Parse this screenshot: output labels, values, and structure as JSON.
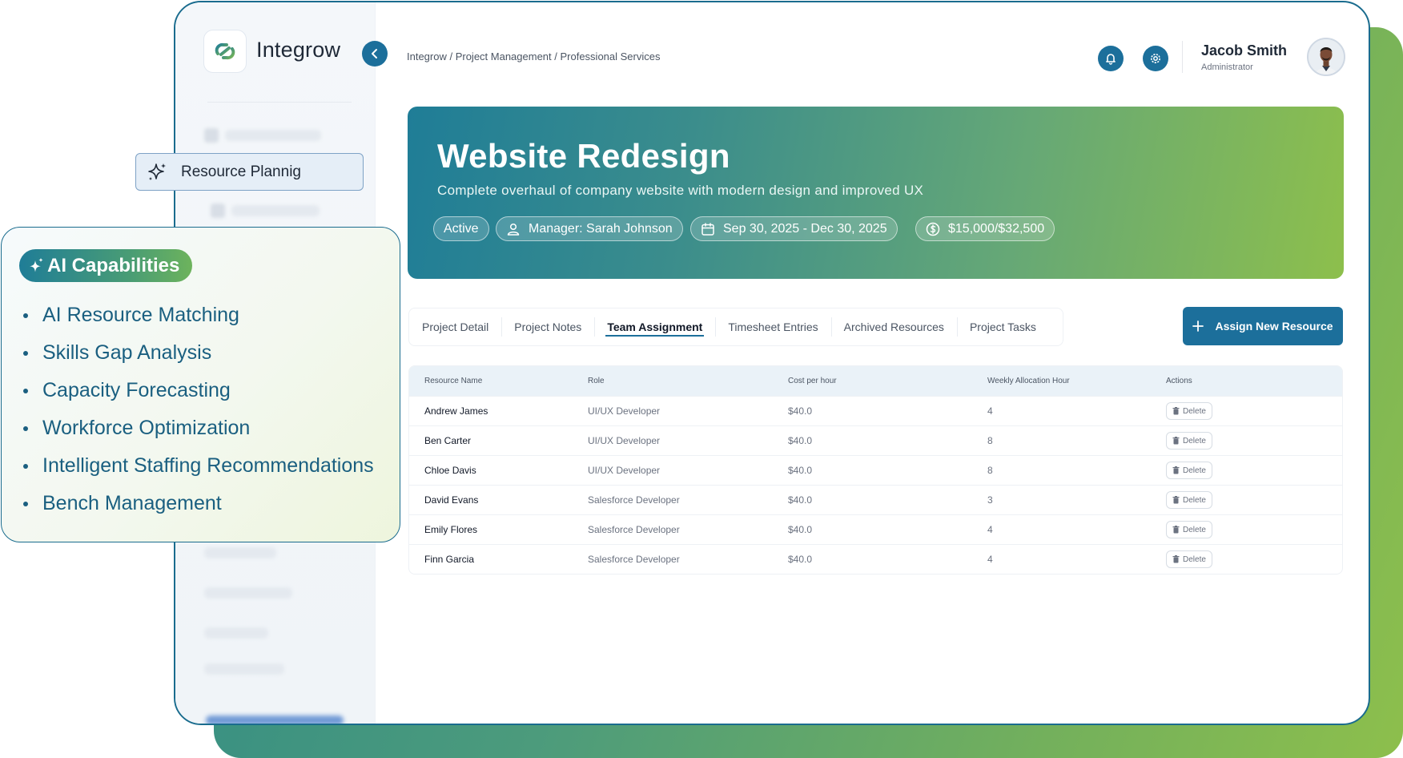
{
  "app": {
    "brand": "Integrow"
  },
  "breadcrumb": "Integrow / Project Management / Professional Services",
  "user": {
    "name": "Jacob Smith",
    "role": "Administrator"
  },
  "project": {
    "title": "Website Redesign",
    "description": "Complete overhaul of company website with modern design and improved UX",
    "status": "Active",
    "manager": "Manager: Sarah Johnson",
    "dates": "Sep 30, 2025 - Dec 30, 2025",
    "budget": "$15,000/$32,500"
  },
  "tabs": [
    {
      "label": "Project Detail"
    },
    {
      "label": "Project Notes"
    },
    {
      "label": "Team Assignment"
    },
    {
      "label": "Timesheet Entries"
    },
    {
      "label": "Archived Resources"
    },
    {
      "label": "Project Tasks"
    }
  ],
  "active_tab": "Team Assignment",
  "assign_button": "Assign New Resource",
  "table": {
    "headers": [
      "Resource Name",
      "Role",
      "Cost per hour",
      "Weekly Allocation Hour",
      "Actions"
    ],
    "rows": [
      {
        "name": "Andrew James",
        "role": "UI/UX Developer",
        "cost": "$40.0",
        "hours": "4",
        "action": "Delete"
      },
      {
        "name": "Ben Carter",
        "role": "UI/UX Developer",
        "cost": "$40.0",
        "hours": "8",
        "action": "Delete"
      },
      {
        "name": "Chloe Davis",
        "role": "UI/UX Developer",
        "cost": "$40.0",
        "hours": "8",
        "action": "Delete"
      },
      {
        "name": "David Evans",
        "role": "Salesforce Developer",
        "cost": "$40.0",
        "hours": "3",
        "action": "Delete"
      },
      {
        "name": "Emily Flores",
        "role": "Salesforce Developer",
        "cost": "$40.0",
        "hours": "4",
        "action": "Delete"
      },
      {
        "name": "Finn Garcia",
        "role": "Salesforce Developer",
        "cost": "$40.0",
        "hours": "4",
        "action": "Delete"
      }
    ]
  },
  "resource_planning": {
    "label": "Resource Plannig"
  },
  "ai_capabilities": {
    "title": "AI Capabilities",
    "items": [
      "AI Resource Matching",
      "Skills Gap Analysis",
      "Capacity Forecasting",
      "Workforce Optimization",
      "Intelligent Staffing Recommendations",
      "Bench Management"
    ]
  },
  "colors": {
    "primary": "#1c6f9b",
    "gradient_start": "#1f7d97",
    "gradient_end": "#8dbf4c",
    "border": "#1a6c8e"
  },
  "icons": [
    "logo-icon",
    "chevron-left-icon",
    "bell-icon",
    "gear-icon",
    "user-icon",
    "calendar-icon",
    "dollar-icon",
    "plus-icon",
    "trash-icon",
    "sparkle-icon"
  ]
}
